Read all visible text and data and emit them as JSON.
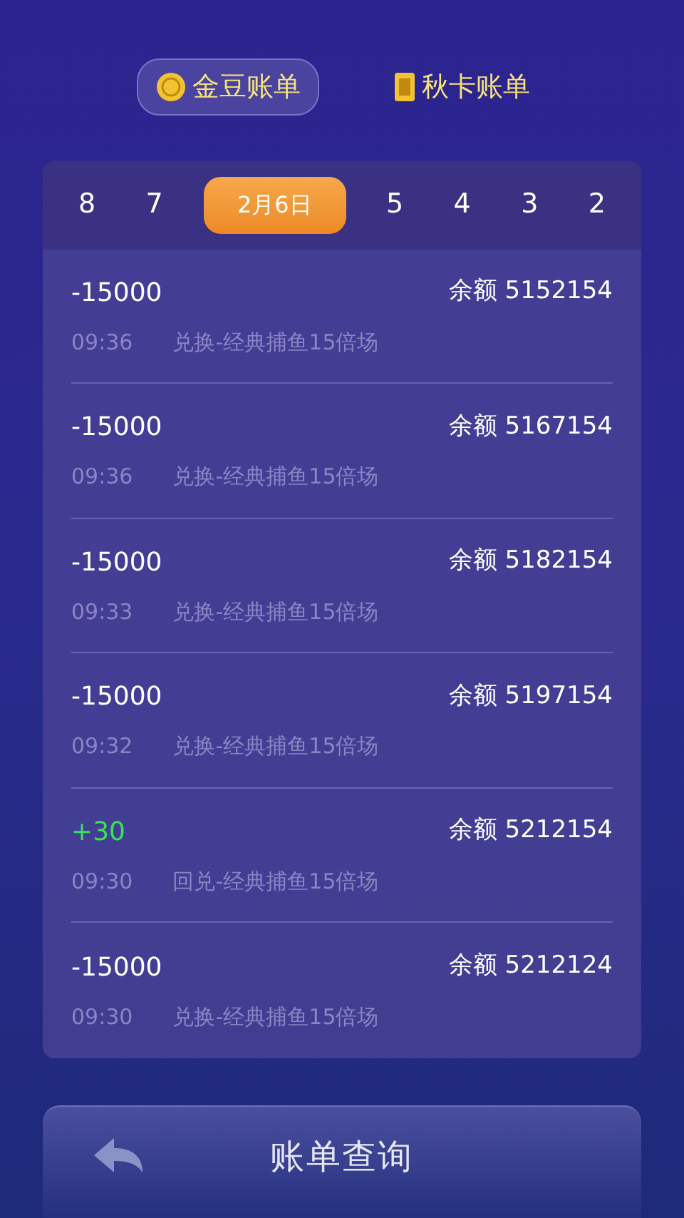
{
  "tabs": [
    {
      "label": "金豆账单",
      "kind": "coin",
      "selected": true
    },
    {
      "label": "秋卡账单",
      "kind": "card",
      "selected": false
    }
  ],
  "dates": [
    {
      "label": "8",
      "selected": false
    },
    {
      "label": "7",
      "selected": false
    },
    {
      "label": "2月6日",
      "selected": true
    },
    {
      "label": "5",
      "selected": false
    },
    {
      "label": "4",
      "selected": false
    },
    {
      "label": "3",
      "selected": false
    },
    {
      "label": "2",
      "selected": false
    }
  ],
  "records": [
    {
      "amount": "-15000",
      "kind": "debit",
      "balance": "余额 5152154",
      "time": "09:36",
      "description": "兑换-经典捕鱼15倍场"
    },
    {
      "amount": "-15000",
      "kind": "debit",
      "balance": "余额 5167154",
      "time": "09:36",
      "description": "兑换-经典捕鱼15倍场"
    },
    {
      "amount": "-15000",
      "kind": "debit",
      "balance": "余额 5182154",
      "time": "09:33",
      "description": "兑换-经典捕鱼15倍场"
    },
    {
      "amount": "-15000",
      "kind": "debit",
      "balance": "余额 5197154",
      "time": "09:32",
      "description": "兑换-经典捕鱼15倍场"
    },
    {
      "amount": "+30",
      "kind": "credit",
      "balance": "余额 5212154",
      "time": "09:30",
      "description": "回兑-经典捕鱼15倍场"
    },
    {
      "amount": "-15000",
      "kind": "debit",
      "balance": "余额 5212124",
      "time": "09:30",
      "description": "兑换-经典捕鱼15倍场"
    }
  ],
  "footer": {
    "title": "账单查询"
  }
}
